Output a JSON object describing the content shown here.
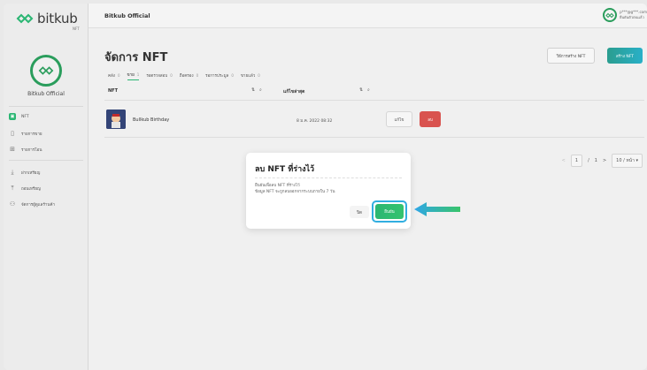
{
  "brand": {
    "logo_text": "bitkub",
    "logo_sub": "NFT",
    "accent": "#2bb673"
  },
  "sidebar": {
    "shop_name": "Bitkub Official",
    "items": [
      {
        "label": "NFT",
        "icon": "nft-icon",
        "active": true
      },
      {
        "label": "รายการขาย",
        "icon": "document-icon"
      },
      {
        "label": "รายการโอน",
        "icon": "gift-icon"
      },
      {
        "label": "ฝากเหรียญ",
        "icon": "download-icon"
      },
      {
        "label": "ถอนเหรียญ",
        "icon": "upload-icon"
      },
      {
        "label": "จัดการผู้ดูแลร้านค้า",
        "icon": "users-icon"
      }
    ]
  },
  "topbar": {
    "title": "Bitkub Official",
    "user_email": "p***@g***.com",
    "user_status": "ยืนยันตัวตนแล้ว"
  },
  "page": {
    "title": "จัดการ NFT",
    "guide_button": "วิธีการสร้าง NFT",
    "create_button": "สร้าง NFT",
    "tabs": [
      {
        "label": "คลัง",
        "count": "0"
      },
      {
        "label": "ขาย",
        "count": "1",
        "active": true
      },
      {
        "label": "รอตรวจสอบ",
        "count": "0"
      },
      {
        "label": "ถือครอง",
        "count": "0"
      },
      {
        "label": "รอการประมูล",
        "count": "0"
      },
      {
        "label": "ขายแล้ว",
        "count": "0"
      }
    ],
    "filters": {
      "col_nft": "NFT",
      "sort_label": "แก้ไขล่าสุด"
    },
    "row": {
      "name": "Bullkub Birthday",
      "date": "8 ม.ค. 2022 08:32",
      "edit": "แก้ไข",
      "delete": "ลบ"
    },
    "pager": {
      "prev": "<",
      "current": "1",
      "sep": "/",
      "total": "1",
      "next": ">",
      "per_page": "10 / หน้า"
    }
  },
  "modal": {
    "title": "ลบ NFT ที่ร่างไว้",
    "line1": "ยืนยันเพื่อลบ NFT ที่ร่างไว้",
    "line2": "ข้อมูล NFT จะถูกลบออกจากระบบภายใน 7 วัน",
    "cancel": "ปิด",
    "confirm": "ยืนยัน"
  }
}
